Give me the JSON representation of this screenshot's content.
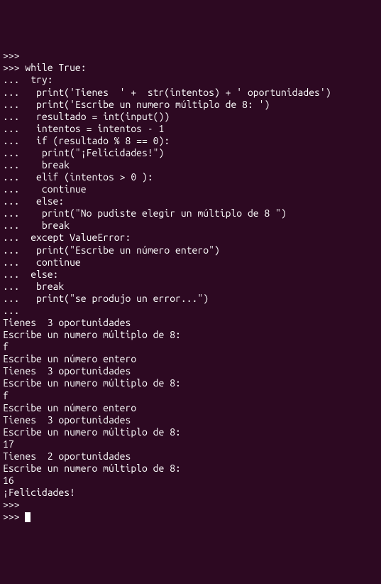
{
  "terminal": {
    "lines": [
      ">>> ",
      ">>> while True:",
      "...  try:",
      "...   print('Tienes  ' +  str(intentos) + ' oportunidades')",
      "...   print('Escribe un numero múltiplo de 8: ')",
      "...   resultado = int(input())",
      "...   intentos = intentos - 1",
      "...   if (resultado % 8 == 0):",
      "...    print(\"¡Felicidades!\")",
      "...    break",
      "...   elif (intentos > 0 ):",
      "...    continue",
      "...   else:",
      "...    print(\"No pudiste elegir un múltiplo de 8 \")",
      "...    break",
      "...  except ValueError:",
      "...   print(\"Escribe un número entero\")",
      "...   continue",
      "...  else:",
      "...   break",
      "...   print(\"se produjo un error...\")",
      "... ",
      "Tienes  3 oportunidades",
      "Escribe un numero múltiplo de 8: ",
      "f",
      "Escribe un número entero",
      "Tienes  3 oportunidades",
      "Escribe un numero múltiplo de 8: ",
      "f",
      "Escribe un número entero",
      "Tienes  3 oportunidades",
      "Escribe un numero múltiplo de 8: ",
      "17",
      "Tienes  2 oportunidades",
      "Escribe un numero múltiplo de 8: ",
      "16",
      "¡Felicidades!",
      ">>> "
    ],
    "prompt_current": ">>> "
  }
}
